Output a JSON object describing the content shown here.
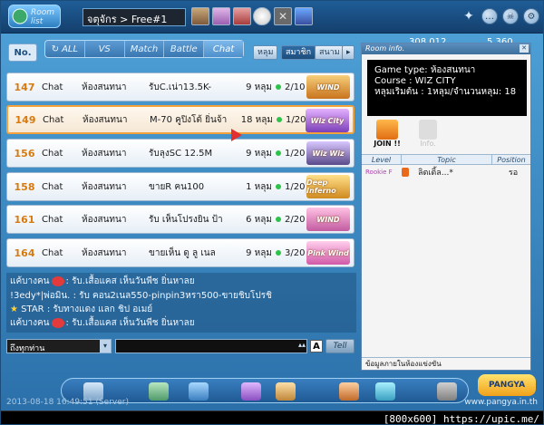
{
  "window": {
    "channel": "จตุจักร > Free#1"
  },
  "status": {
    "left": "308 012",
    "right": "5 360"
  },
  "tabs": {
    "no_label": "No.",
    "modes": [
      {
        "label": "ALL"
      },
      {
        "label": "VS"
      },
      {
        "label": "Match"
      },
      {
        "label": "Battle"
      },
      {
        "label": "Chat"
      }
    ],
    "filters": [
      {
        "label": "หลุม"
      },
      {
        "label": "สมาชิก"
      },
      {
        "label": "สนาม"
      }
    ]
  },
  "rooms": [
    {
      "num": "147",
      "mode": "Chat",
      "course": "ห้องสนทนา",
      "title": "รับC.เน่า13.5K-",
      "holes": "9 หลุม",
      "count": "2/10",
      "badge": "WIND",
      "badge_color": "#c9731e"
    },
    {
      "num": "149",
      "mode": "Chat",
      "course": "ห้องสนทนา",
      "title": "M-70 คูปิงโต้ ยิ่นจ้า",
      "holes": "18 หลุม",
      "count": "1/20",
      "badge": "Wiz City",
      "badge_color": "#7b3fb8",
      "selected": true
    },
    {
      "num": "156",
      "mode": "Chat",
      "course": "ห้องสนทนา",
      "title": "รับลุงSC 12.5M",
      "holes": "9 หลุม",
      "count": "1/20",
      "badge": "Wiz Wiz",
      "badge_color": "#5a4a8a"
    },
    {
      "num": "158",
      "mode": "Chat",
      "course": "ห้องสนทนา",
      "title": "ขายR ฅน100",
      "holes": "1 หลุม",
      "count": "1/20",
      "badge": "Deep Inferno",
      "badge_color": "#d08a20"
    },
    {
      "num": "161",
      "mode": "Chat",
      "course": "ห้องสนทนา",
      "title": "รับ เห็นโปรงยิน ป้า",
      "holes": "6 หลุม",
      "count": "2/20",
      "badge": "WIND",
      "badge_color": "#c25ba0"
    },
    {
      "num": "164",
      "mode": "Chat",
      "course": "ห้องสนทนา",
      "title": "ขายเห็น ดู ลู เนล",
      "holes": "9 หลุม",
      "count": "3/20",
      "badge": "Pink Wind",
      "badge_color": "#d15aa8"
    }
  ],
  "chat": [
    {
      "name": "แค้บางคน",
      "text": ": รับ.เสื้อแคส เห็นวันพีช ยิ่นหาลย"
    },
    {
      "name": "!3edy*|พ่อมิน.",
      "text": ": รับ คอน2เนล550-pinpin3หรา500-ขายชิบโปรชิ"
    },
    {
      "name": "STAR",
      "text": ": รับทางแดง แลก ชิป อเมย์"
    },
    {
      "name": "แค้บางคน",
      "text": ": รับ.เสื้อแคส เห็นวันพีช ยิ่นหาลย"
    }
  ],
  "input": {
    "target": "ถึงทุกท่าน",
    "a_label": "A",
    "tell_label": "Tell"
  },
  "room_info": {
    "title": "Room info.",
    "game_type": "Game type: ห้องสนทนา",
    "course": "Course : WIZ CITY",
    "holes": "หลุมเริ่มต้น : 1หลุม/จำนวนหลุม: 18 หลุม",
    "join_label": "JOIN !!",
    "info_label": "Info.",
    "columns": [
      "Level",
      "Topic",
      "Position"
    ],
    "players": [
      {
        "level": "Rookie F",
        "topic": "ลิตเติ้ล...*",
        "position": "รอ"
      }
    ],
    "footer": "ข้อมูลภายในห้องแข่งขัน"
  },
  "bottom": {
    "timestamp": "2013-08-18 16:49:51 (Server)",
    "brand": "PANGYA",
    "site": "www.pangya.in.th",
    "resolution_tag": "[800x600] https://upic.me/"
  }
}
